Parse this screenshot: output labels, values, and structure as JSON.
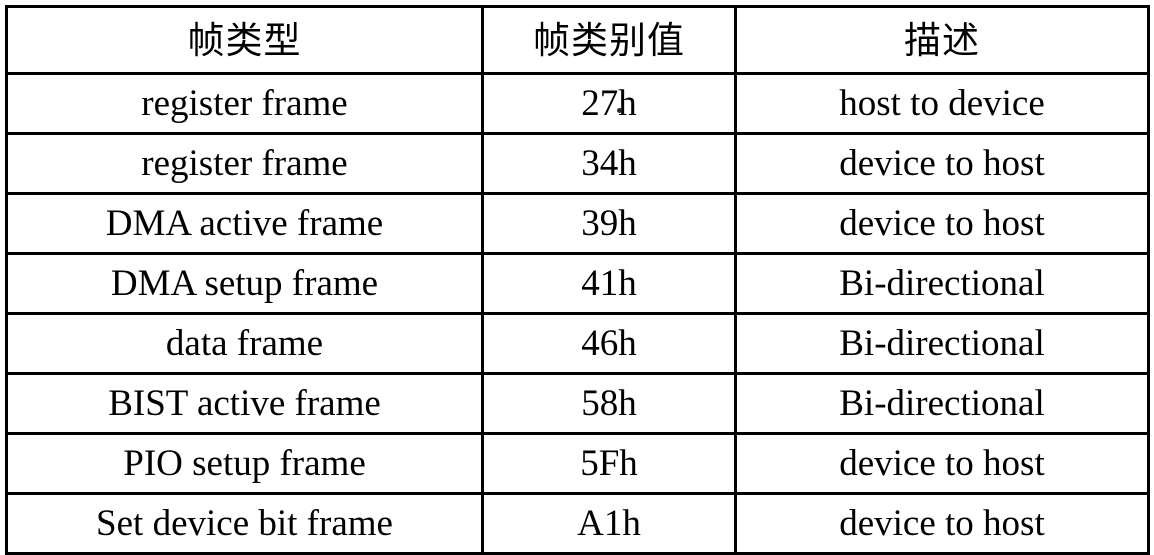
{
  "table": {
    "headers": [
      "帧类型",
      "帧类别值",
      "描述"
    ],
    "rows": [
      {
        "frame_type": "register frame",
        "type_value": "27h",
        "description": "host to device"
      },
      {
        "frame_type": "register frame",
        "type_value": "34h",
        "description": "device to host"
      },
      {
        "frame_type": "DMA active frame",
        "type_value": "39h",
        "description": "device to host"
      },
      {
        "frame_type": "DMA setup frame",
        "type_value": "41h",
        "description": "Bi-directional"
      },
      {
        "frame_type": "data frame",
        "type_value": "46h",
        "description": "Bi-directional"
      },
      {
        "frame_type": "BIST active frame",
        "type_value": "58h",
        "description": "Bi-directional"
      },
      {
        "frame_type": "PIO setup frame",
        "type_value": "5Fh",
        "description": "device to host"
      },
      {
        "frame_type": "Set device bit frame",
        "type_value": "A1h",
        "description": "device to host"
      }
    ]
  },
  "colors": {
    "text": "#000000",
    "border": "#000000",
    "background": "#ffffff"
  }
}
